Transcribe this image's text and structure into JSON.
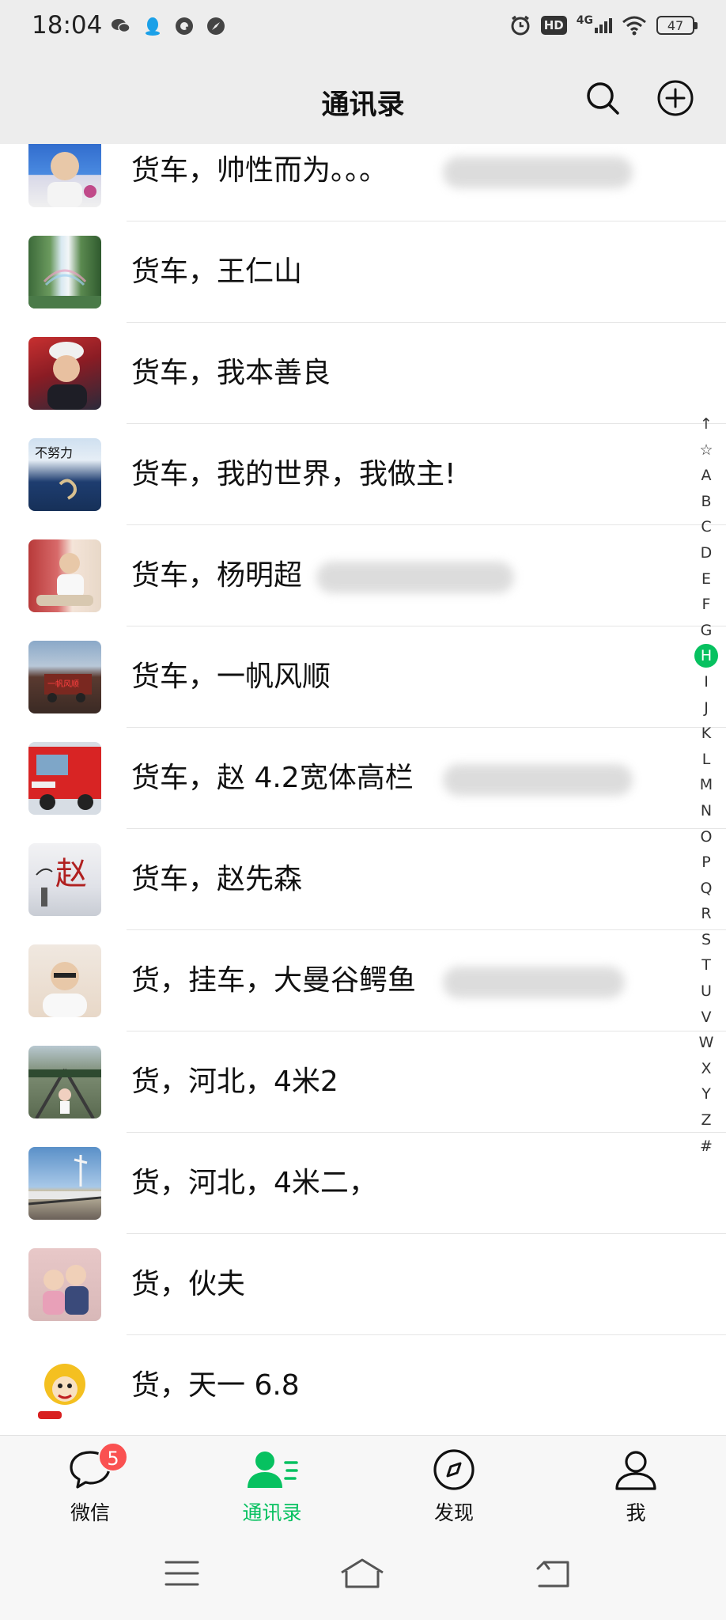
{
  "status_bar": {
    "time": "18:04",
    "left_icons": [
      "wechat-icon",
      "qq-icon",
      "q-app-icon",
      "compass-app-icon"
    ],
    "hd": "HD",
    "network": "4G",
    "battery": "47"
  },
  "header": {
    "title": "通讯录",
    "search_icon": "search-icon",
    "add_icon": "add-circle-icon"
  },
  "contacts": [
    {
      "name": "货车，帅性而为。。。",
      "redacted": true
    },
    {
      "name": "货车，王仁山",
      "redacted": false
    },
    {
      "name": "货车，我本善良",
      "redacted": false
    },
    {
      "name": "货车，我的世界，我做主!",
      "redacted": false
    },
    {
      "name": "货车，杨明超",
      "redacted": true
    },
    {
      "name": "货车，一帆风顺",
      "redacted": false
    },
    {
      "name": "货车，赵  4.2宽体高栏",
      "redacted": true
    },
    {
      "name": "货车，赵先森",
      "redacted": false
    },
    {
      "name": "货，挂车，大曼谷鳄鱼",
      "redacted": true
    },
    {
      "name": "货，河北，4米2",
      "redacted": false
    },
    {
      "name": "货，河北，4米二，",
      "redacted": false
    },
    {
      "name": "货，伙夫",
      "redacted": false
    },
    {
      "name": "货，天一  6.8",
      "redacted": false
    }
  ],
  "index": {
    "letters": [
      "↑",
      "☆",
      "A",
      "B",
      "C",
      "D",
      "E",
      "F",
      "G",
      "H",
      "I",
      "J",
      "K",
      "L",
      "M",
      "N",
      "O",
      "P",
      "Q",
      "R",
      "S",
      "T",
      "U",
      "V",
      "W",
      "X",
      "Y",
      "Z",
      "#"
    ],
    "active": "H"
  },
  "tabs": [
    {
      "label": "微信",
      "icon": "chat-bubble-icon",
      "badge": "5",
      "active": false
    },
    {
      "label": "通讯录",
      "icon": "contacts-icon",
      "active": true
    },
    {
      "label": "发现",
      "icon": "compass-icon",
      "active": false
    },
    {
      "label": "我",
      "icon": "person-icon",
      "active": false
    }
  ],
  "nav": [
    "menu-icon",
    "home-icon",
    "back-icon"
  ],
  "colors": {
    "accent": "#07c160",
    "badge": "#fa5151",
    "header_bg": "#ededed",
    "list_bg": "#ffffff"
  }
}
